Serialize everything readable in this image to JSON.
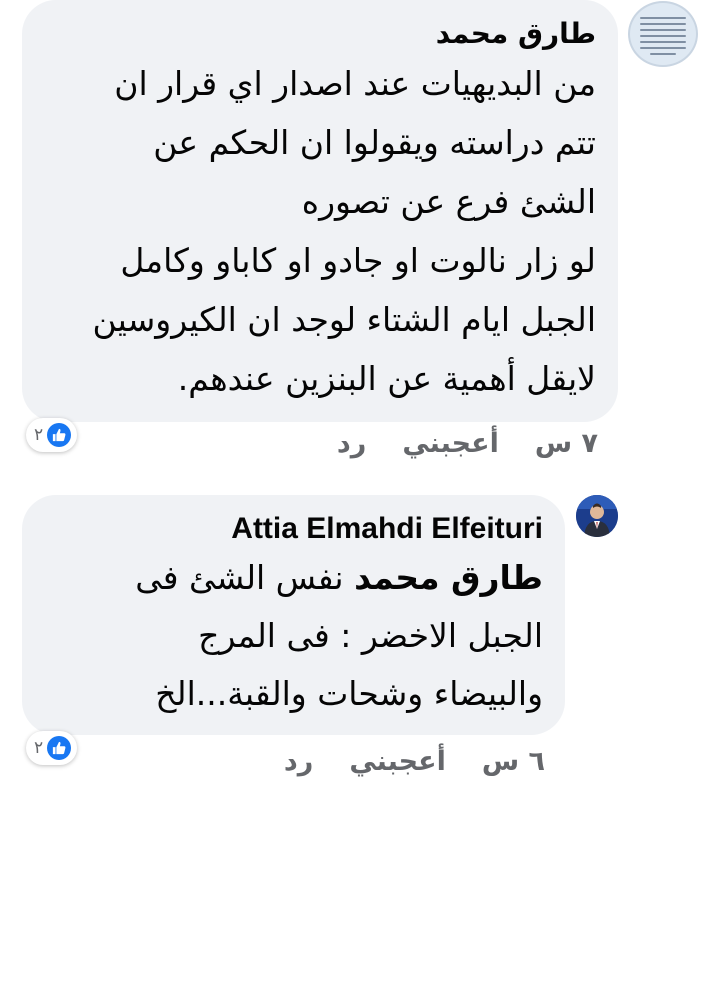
{
  "comments": [
    {
      "author": "طارق محمد",
      "lines": [
        "من البديهيات عند اصدار اي قرار ان",
        "تتم دراسته ويقولوا ان الحكم عن",
        "الشئ فرع عن تصوره",
        "لو زار نالوت او جادو او كاباو وكامل",
        "الجبل ايام الشتاء لوجد ان الكيروسين",
        "لايقل أهمية عن البنزين عندهم."
      ],
      "reaction_count": "٢",
      "time": "٧ س",
      "like_label": "أعجبني",
      "reply_label": "رد",
      "avatar_icon": "text-image-avatar-icon"
    },
    {
      "author": "Attia Elmahdi Elfeituri",
      "mention": "طارق محمد",
      "lines": [
        "نفس الشئ  فى",
        "الجبل الاخضر : فى المرج",
        "والبيضاء وشحات والقبة...الخ"
      ],
      "reaction_count": "٢",
      "time": "٦ س",
      "like_label": "أعجبني",
      "reply_label": "رد",
      "avatar_icon": "person-avatar-icon"
    }
  ],
  "colors": {
    "bubble": "#f0f2f5",
    "text": "#050505",
    "meta": "#65676b",
    "like_blue": "#1877f2"
  }
}
